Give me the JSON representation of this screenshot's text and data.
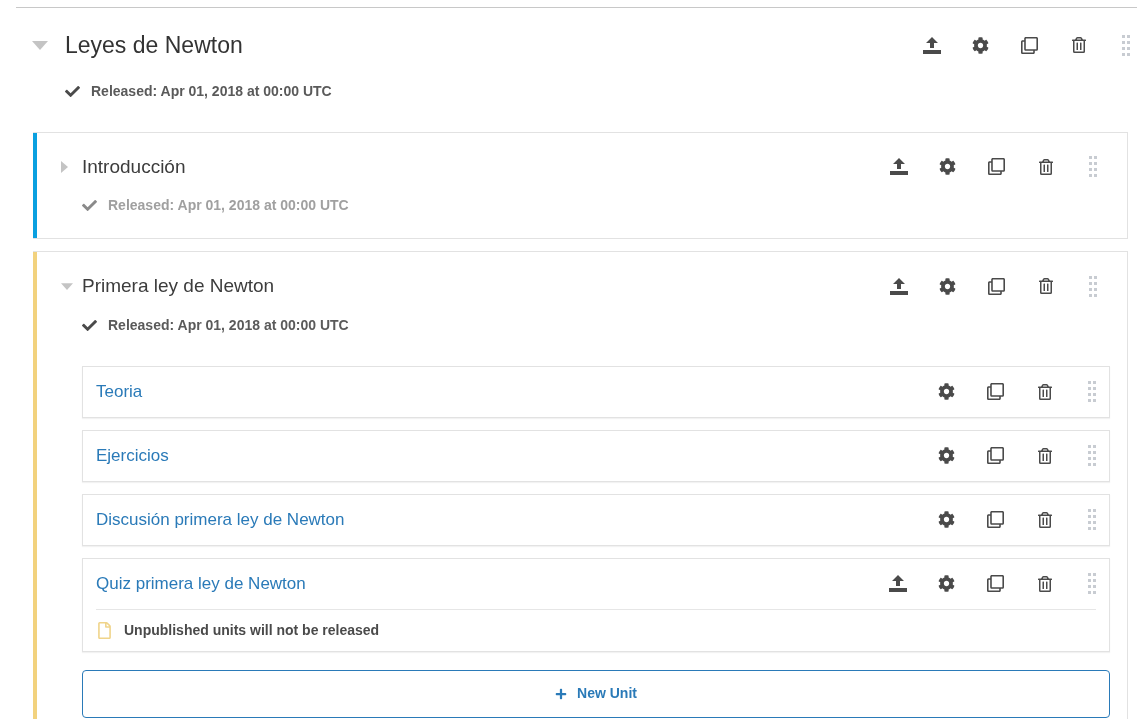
{
  "section": {
    "title": "Leyes de Newton",
    "expanded": true,
    "released": "Released: Apr 01, 2018 at 00:00 UTC",
    "publish": true
  },
  "subsections": [
    {
      "title": "Introducción",
      "expanded": false,
      "color": "#0aa0e0",
      "released": "Released: Apr 01, 2018 at 00:00 UTC",
      "released_muted": true,
      "publish": true
    },
    {
      "title": "Primera ley de Newton",
      "expanded": true,
      "color": "#f2d27e",
      "released": "Released: Apr 01, 2018 at 00:00 UTC",
      "released_muted": false,
      "publish": true,
      "units": [
        {
          "title": "Teoria",
          "publish": false
        },
        {
          "title": "Ejercicios",
          "publish": false
        },
        {
          "title": "Discusión primera ley de Newton",
          "publish": false
        },
        {
          "title": "Quiz primera ley de Newton",
          "publish": true,
          "warning": "Unpublished units will not be released"
        }
      ],
      "new_unit_button": "New Unit"
    }
  ]
}
